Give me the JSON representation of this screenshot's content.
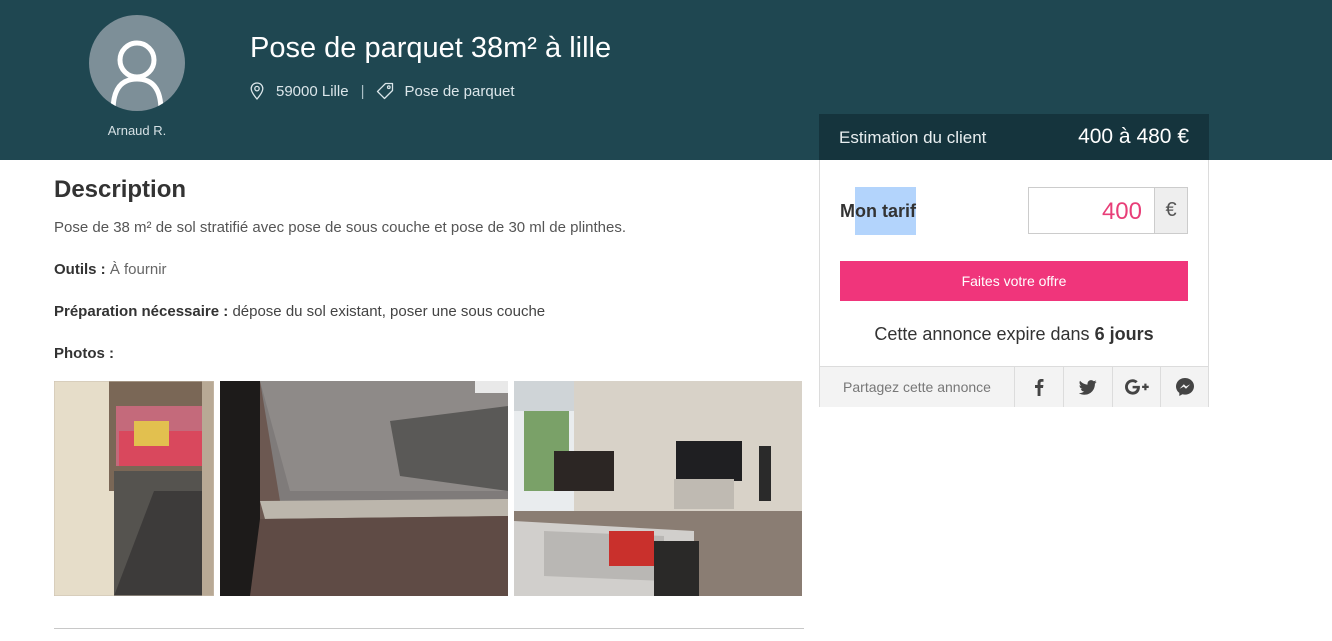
{
  "header": {
    "user_name": "Arnaud R.",
    "title": "Pose de parquet 38m² à lille",
    "location": "59000 Lille",
    "separator": "|",
    "category": "Pose de parquet"
  },
  "description": {
    "heading": "Description",
    "text": "Pose de 38 m² de sol stratifié avec pose de sous couche et pose de 30 ml de plinthes.",
    "tools_label": "Outils :",
    "tools_value": "À fournir",
    "prep_label": "Préparation nécessaire :",
    "prep_value": "dépose du sol existant, poser une sous couche",
    "photos_label": "Photos :"
  },
  "panel": {
    "estimate_label": "Estimation du client",
    "estimate_value": "400 à 480 €",
    "tarif_label_start": "M",
    "tarif_label_hl": "on tarif",
    "tarif_value": "400",
    "tarif_unit": "€",
    "offer_button": "Faites votre offre",
    "expire_text": "Cette annonce expire dans",
    "expire_days": "6 jours",
    "share_label": "Partagez cette annonce"
  },
  "icons": [
    "user-avatar-icon",
    "map-pin-icon",
    "tag-icon",
    "facebook-icon",
    "twitter-icon",
    "google-plus-icon",
    "messenger-icon"
  ],
  "colors": {
    "header_bg": "#1f4751",
    "estimate_bg": "#15343d",
    "accent": "#f0357b",
    "price": "#e83e78"
  }
}
